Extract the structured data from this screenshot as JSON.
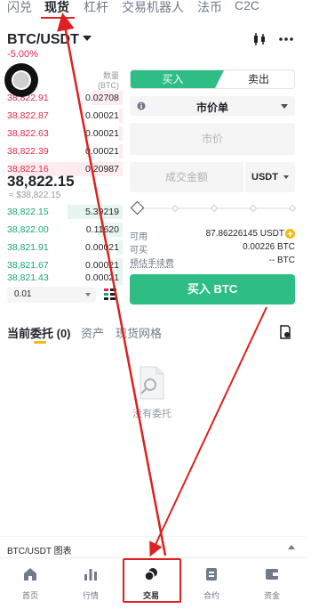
{
  "top_tabs": [
    "闪兑",
    "现货",
    "杠杆",
    "交易机器人",
    "法币",
    "C2C"
  ],
  "pair": {
    "name": "BTC/USDT",
    "change": "-5.00%"
  },
  "order_book": {
    "qty_header_line1": "数量",
    "qty_header_line2": "(BTC)",
    "asks": [
      {
        "price": "38,822.91",
        "qty": "0.02708",
        "depth": 0.25
      },
      {
        "price": "38,822.87",
        "qty": "0.00021",
        "depth": 0.03
      },
      {
        "price": "38,822.63",
        "qty": "0.00021",
        "depth": 0.03
      },
      {
        "price": "38,822.39",
        "qty": "0.00021",
        "depth": 0.03
      },
      {
        "price": "38,822.16",
        "qty": "0.20987",
        "depth": 0.9
      }
    ],
    "mid_price": "38,822.15",
    "mid_fiat": "≈ $38,822.15",
    "bids": [
      {
        "price": "38,822.15",
        "qty": "5.39219",
        "depth": 0.45
      },
      {
        "price": "38,822.00",
        "qty": "0.11620",
        "depth": 0.2
      },
      {
        "price": "38,821.91",
        "qty": "0.00021",
        "depth": 0.05
      },
      {
        "price": "38,821.67",
        "qty": "0.00021",
        "depth": 0.05
      },
      {
        "price": "38,821.43",
        "qty": "0.00021",
        "depth": 0.05
      }
    ],
    "precision": "0.01"
  },
  "trade_panel": {
    "buy_tab": "买入",
    "sell_tab": "卖出",
    "order_type": "市价单",
    "price_placeholder": "市价",
    "amount_placeholder": "成交金额",
    "amount_unit": "USDT",
    "available_label": "可用",
    "available_value": "87.86226145 USDT",
    "can_buy_label": "可买",
    "can_buy_value": "0.00226 BTC",
    "fee_label": "预估手续费",
    "fee_value": "-- BTC",
    "buy_button": "买入 BTC"
  },
  "orders": {
    "tabs": [
      "当前委托 (0)",
      "资产",
      "现货网格"
    ],
    "empty": "没有委托"
  },
  "chart_bar": {
    "label": "BTC/USDT 图表"
  },
  "nav": {
    "items": [
      {
        "label": "首页",
        "icon": "home-icon"
      },
      {
        "label": "行情",
        "icon": "markets-icon"
      },
      {
        "label": "交易",
        "icon": "trade-icon"
      },
      {
        "label": "合约",
        "icon": "futures-icon"
      },
      {
        "label": "资金",
        "icon": "wallet-icon"
      }
    ],
    "active_index": 2
  },
  "colors": {
    "buy": "#2ebd85",
    "sell_price": "#e0294a",
    "buy_price": "#17a774",
    "accent": "#f0b90b",
    "annotation": "#e02020"
  }
}
